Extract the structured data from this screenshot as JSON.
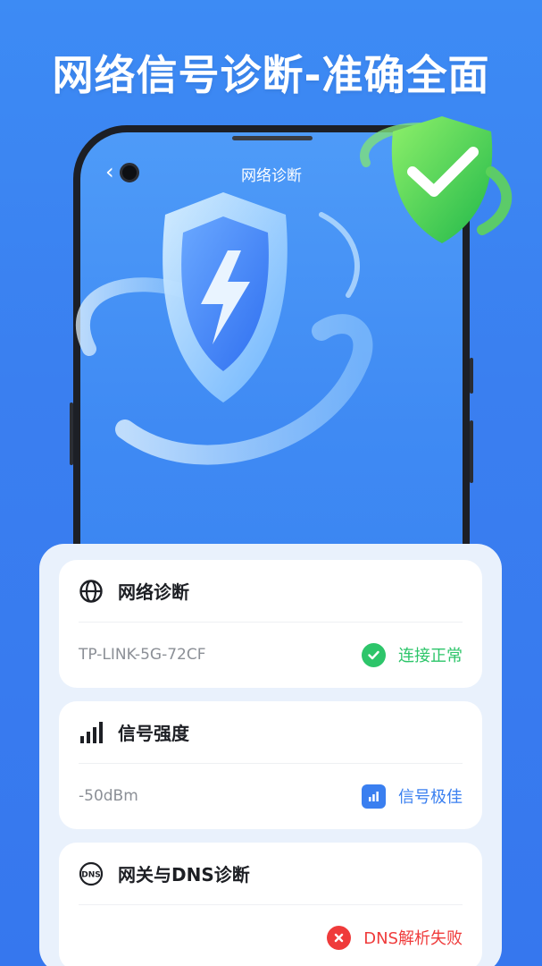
{
  "headline": "网络信号诊断-准确全面",
  "phone": {
    "title": "网络诊断",
    "back_icon": "chevron-left-icon"
  },
  "cards": [
    {
      "title": "网络诊断",
      "icon": "globe-icon",
      "value": "TP-LINK-5G-72CF",
      "status": "连接正常",
      "status_icon": "check-circle-icon",
      "status_color": "#2dc56a"
    },
    {
      "title": "信号强度",
      "icon": "signal-bars-icon",
      "value": "-50dBm",
      "status": "信号极佳",
      "status_icon": "signal-chart-icon",
      "status_color": "#3a7ff0"
    },
    {
      "title": "网关与DNS诊断",
      "icon": "dns-icon",
      "value": "",
      "status": "DNS解析失败",
      "status_icon": "error-circle-icon",
      "status_color": "#ef3b3b"
    }
  ]
}
